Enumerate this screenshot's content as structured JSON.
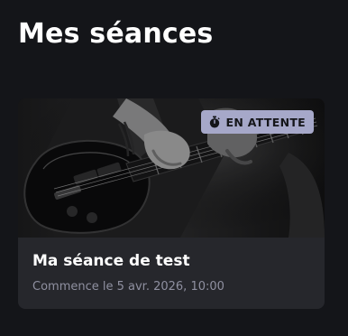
{
  "page": {
    "title": "Mes séances"
  },
  "session_card": {
    "status_icon": "stopwatch-icon",
    "status_label": "EN ATTENTE",
    "title": "Ma séance de test",
    "subtitle": "Commence le 5 avr. 2026, 10:00",
    "image": "guitar-photo",
    "colors": {
      "card_background": "#26272c",
      "badge_background": "#a6a8c9",
      "subtitle_text": "#8f90a0"
    }
  },
  "colors": {
    "page_background": "#141519"
  }
}
